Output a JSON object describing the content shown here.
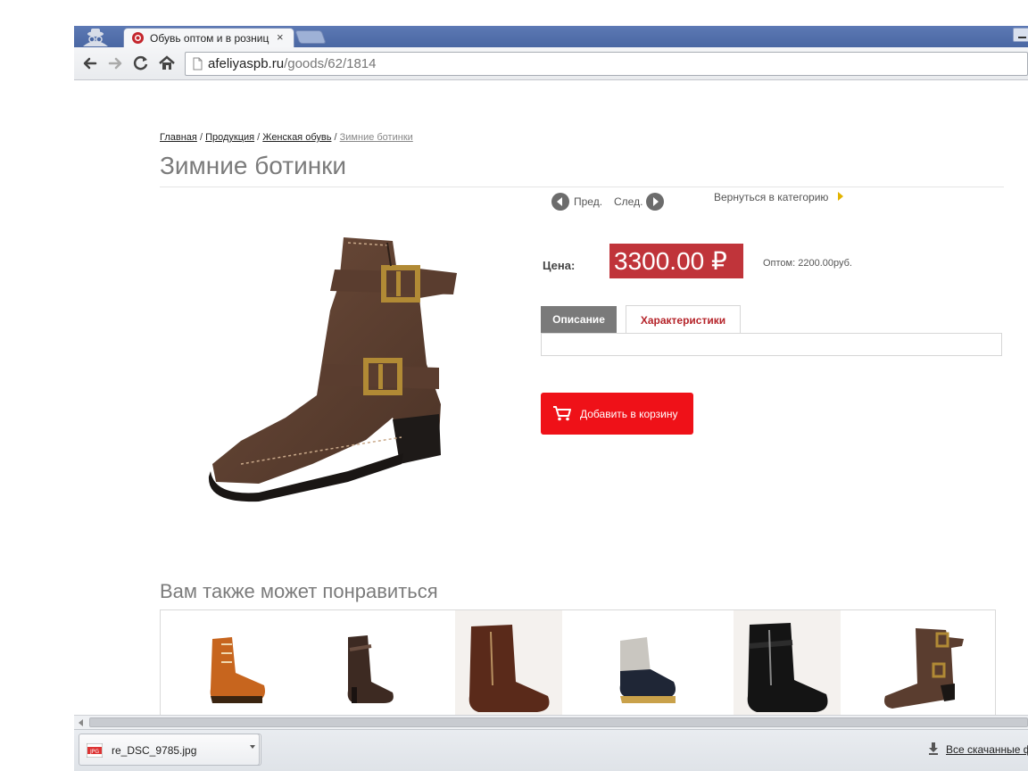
{
  "browser": {
    "tab_title": "Обувь оптом и в розниц",
    "tab_close": "×",
    "url_host": "afeliyaspb.ru",
    "url_path": "/goods/62/1814",
    "icons": [
      "incognito-icon",
      "favicon-icon",
      "back-arrow-icon",
      "forward-arrow-icon",
      "reload-icon",
      "home-icon",
      "page-icon"
    ]
  },
  "breadcrumb": {
    "items": [
      "Главная",
      "Продукция",
      "Женская обувь"
    ],
    "separator": "/",
    "current": "Зимние ботинки"
  },
  "product": {
    "title": "Зимние ботинки",
    "prev_label": "Пред.",
    "next_label": "След.",
    "back_to_category": "Вернуться в категорию",
    "price_label": "Цена:",
    "price_value": "3300.00",
    "currency_symbol": "₽",
    "wholesale_text": "Оптом: 2200.00руб.",
    "tabs": [
      {
        "label": "Описание",
        "active": false
      },
      {
        "label": "Характеристики",
        "active": true
      }
    ],
    "add_to_cart_label": "Добавить в корзину"
  },
  "related": {
    "title": "Вам также может понравиться",
    "items": [
      {
        "name": "orange-lace-up-boot"
      },
      {
        "name": "dark-brown-ankle-boot"
      },
      {
        "name": "brown-leather-zip-boot"
      },
      {
        "name": "navy-grey-lace-up-boot"
      },
      {
        "name": "black-leather-zip-boot"
      },
      {
        "name": "brown-buckle-boot"
      }
    ]
  },
  "downloads": {
    "file_name": "re_DSC_9785.jpg",
    "file_type": "JPG",
    "all_downloads_label": "Все скачанные ф"
  },
  "colors": {
    "price_bg": "#c0343a",
    "cart_button": "#ef1118",
    "active_tab_text": "#b5242a",
    "inactive_tab_bg": "#7a7a7a",
    "title_gray": "#7b7b7b"
  }
}
